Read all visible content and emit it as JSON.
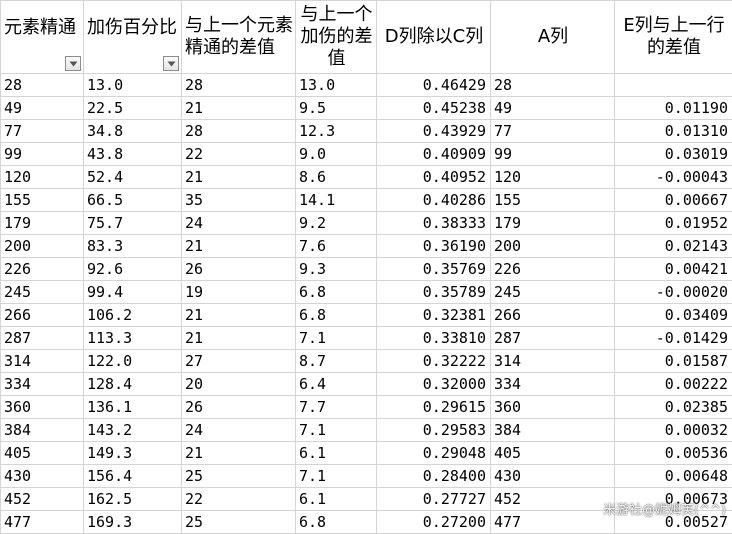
{
  "sheet": {
    "headers": [
      {
        "label": "元素精通",
        "align": "left",
        "filter": true
      },
      {
        "label": "加伤百分比",
        "align": "left",
        "filter": true
      },
      {
        "label": "与上一个元素精通的差值",
        "align": "left",
        "filter": false
      },
      {
        "label": "与上一个加伤的差值",
        "align": "center",
        "filter": false
      },
      {
        "label": "D列除以C列",
        "align": "center",
        "filter": false
      },
      {
        "label": "A列",
        "align": "center",
        "filter": false
      },
      {
        "label": "E列与上一行的差值",
        "align": "center",
        "filter": false
      }
    ],
    "column_align": [
      "txt",
      "txt",
      "txt",
      "txt",
      "num",
      "txt",
      "num"
    ],
    "rows": [
      [
        "28",
        "13.0",
        "28",
        "13.0",
        "0.46429",
        "28",
        ""
      ],
      [
        "49",
        "22.5",
        "21",
        "9.5",
        "0.45238",
        "49",
        "0.01190"
      ],
      [
        "77",
        "34.8",
        "28",
        "12.3",
        "0.43929",
        "77",
        "0.01310"
      ],
      [
        "99",
        "43.8",
        "22",
        "9.0",
        "0.40909",
        "99",
        "0.03019"
      ],
      [
        "120",
        "52.4",
        "21",
        "8.6",
        "0.40952",
        "120",
        "-0.00043"
      ],
      [
        "155",
        "66.5",
        "35",
        "14.1",
        "0.40286",
        "155",
        "0.00667"
      ],
      [
        "179",
        "75.7",
        "24",
        "9.2",
        "0.38333",
        "179",
        "0.01952"
      ],
      [
        "200",
        "83.3",
        "21",
        "7.6",
        "0.36190",
        "200",
        "0.02143"
      ],
      [
        "226",
        "92.6",
        "26",
        "9.3",
        "0.35769",
        "226",
        "0.00421"
      ],
      [
        "245",
        "99.4",
        "19",
        "6.8",
        "0.35789",
        "245",
        "-0.00020"
      ],
      [
        "266",
        "106.2",
        "21",
        "6.8",
        "0.32381",
        "266",
        "0.03409"
      ],
      [
        "287",
        "113.3",
        "21",
        "7.1",
        "0.33810",
        "287",
        "-0.01429"
      ],
      [
        "314",
        "122.0",
        "27",
        "8.7",
        "0.32222",
        "314",
        "0.01587"
      ],
      [
        "334",
        "128.4",
        "20",
        "6.4",
        "0.32000",
        "334",
        "0.00222"
      ],
      [
        "360",
        "136.1",
        "26",
        "7.7",
        "0.29615",
        "360",
        "0.02385"
      ],
      [
        "384",
        "143.2",
        "24",
        "7.1",
        "0.29583",
        "384",
        "0.00032"
      ],
      [
        "405",
        "149.3",
        "21",
        "6.1",
        "0.29048",
        "405",
        "0.00536"
      ],
      [
        "430",
        "156.4",
        "25",
        "7.1",
        "0.28400",
        "430",
        "0.00648"
      ],
      [
        "452",
        "162.5",
        "22",
        "6.1",
        "0.27727",
        "452",
        "0.00673"
      ],
      [
        "477",
        "169.3",
        "25",
        "6.8",
        "0.27200",
        "477",
        "0.00527"
      ]
    ]
  },
  "watermark": "米游社@妮姆芙(^^)",
  "icons": {
    "filter": "filter-dropdown-icon"
  }
}
